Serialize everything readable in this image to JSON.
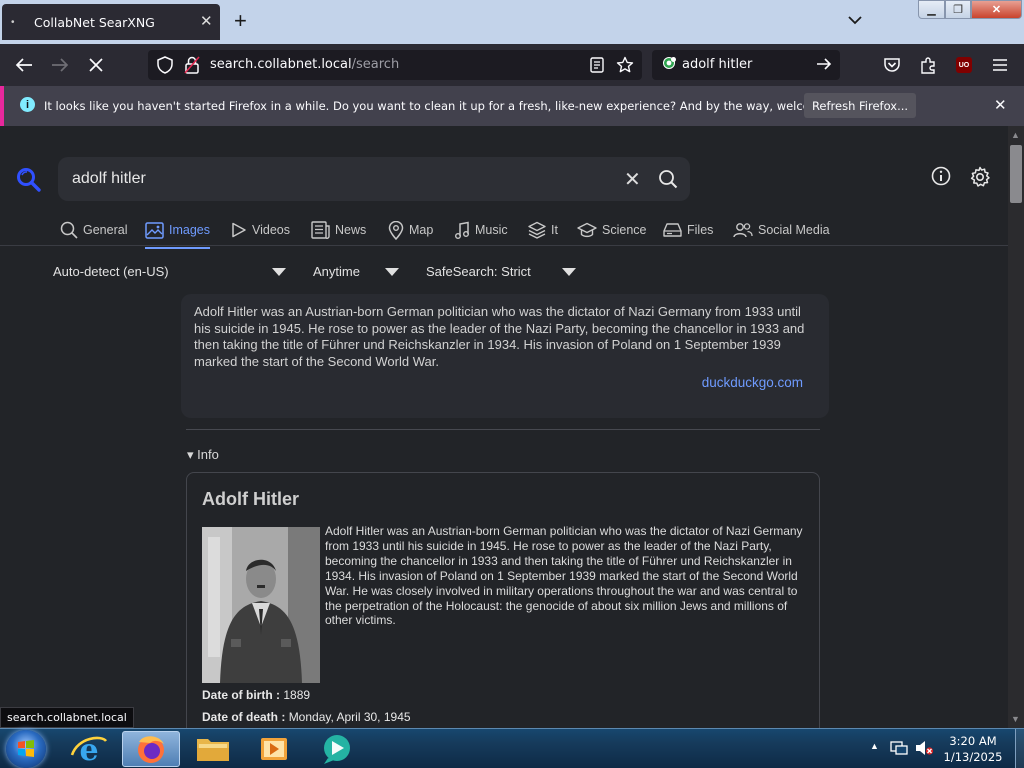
{
  "browser": {
    "tab_title": "CollabNet SearXNG",
    "url_domain": "search.collabnet.local",
    "url_path": "/search",
    "search_box_query": "adolf hitler"
  },
  "notification": {
    "message": "It looks like you haven't started Firefox in a while. Do you want to clean it up for a fresh, like-new experience? And by the way, welcome back!",
    "button_label": "Refresh Firefox..."
  },
  "search": {
    "query": "adolf hitler"
  },
  "categories": [
    {
      "label": "General",
      "icon": "search-icon"
    },
    {
      "label": "Images",
      "icon": "image-icon",
      "active": true
    },
    {
      "label": "Videos",
      "icon": "play-icon"
    },
    {
      "label": "News",
      "icon": "newspaper-icon"
    },
    {
      "label": "Map",
      "icon": "map-pin-icon"
    },
    {
      "label": "Music",
      "icon": "music-note-icon"
    },
    {
      "label": "It",
      "icon": "layers-icon"
    },
    {
      "label": "Science",
      "icon": "graduation-cap-icon"
    },
    {
      "label": "Files",
      "icon": "drive-icon"
    },
    {
      "label": "Social Media",
      "icon": "people-icon"
    }
  ],
  "filters": {
    "language": "Auto-detect (en-US)",
    "time_range": "Anytime",
    "safesearch": "SafeSearch: Strict"
  },
  "abstract": {
    "text": "Adolf Hitler was an Austrian-born German politician who was the dictator of Nazi Germany from 1933 until his suicide in 1945. He rose to power as the leader of the Nazi Party, becoming the chancellor in 1933 and then taking the title of Führer und Reichskanzler in 1934. His invasion of Poland on 1 September 1939 marked the start of the Second World War.",
    "source": "duckduckgo.com"
  },
  "infobox": {
    "toggle_label": "▾ Info",
    "title": "Adolf Hitler",
    "description": "Adolf Hitler was an Austrian-born German politician who was the dictator of Nazi Germany from 1933 until his suicide in 1945. He rose to power as the leader of the Nazi Party, becoming the chancellor in 1933 and then taking the title of Führer und Reichskanzler in 1934. His invasion of Poland on 1 September 1939 marked the start of the Second World War. He was closely involved in military operations throughout the war and was central to the perpetration of the Holocaust: the genocide of about six million Jews and millions of other victims.",
    "attributes": [
      {
        "label": "Date of birth :",
        "value": "1889"
      },
      {
        "label": "Date of death :",
        "value": "Monday, April 30, 1945"
      }
    ]
  },
  "status_bar_url": "search.collabnet.local",
  "taskbar": {
    "time": "3:20 AM",
    "date": "1/13/2025"
  },
  "colors": {
    "accent": "#6f9bff",
    "notification_stripe": "#e8289c",
    "page_bg": "#222428"
  }
}
